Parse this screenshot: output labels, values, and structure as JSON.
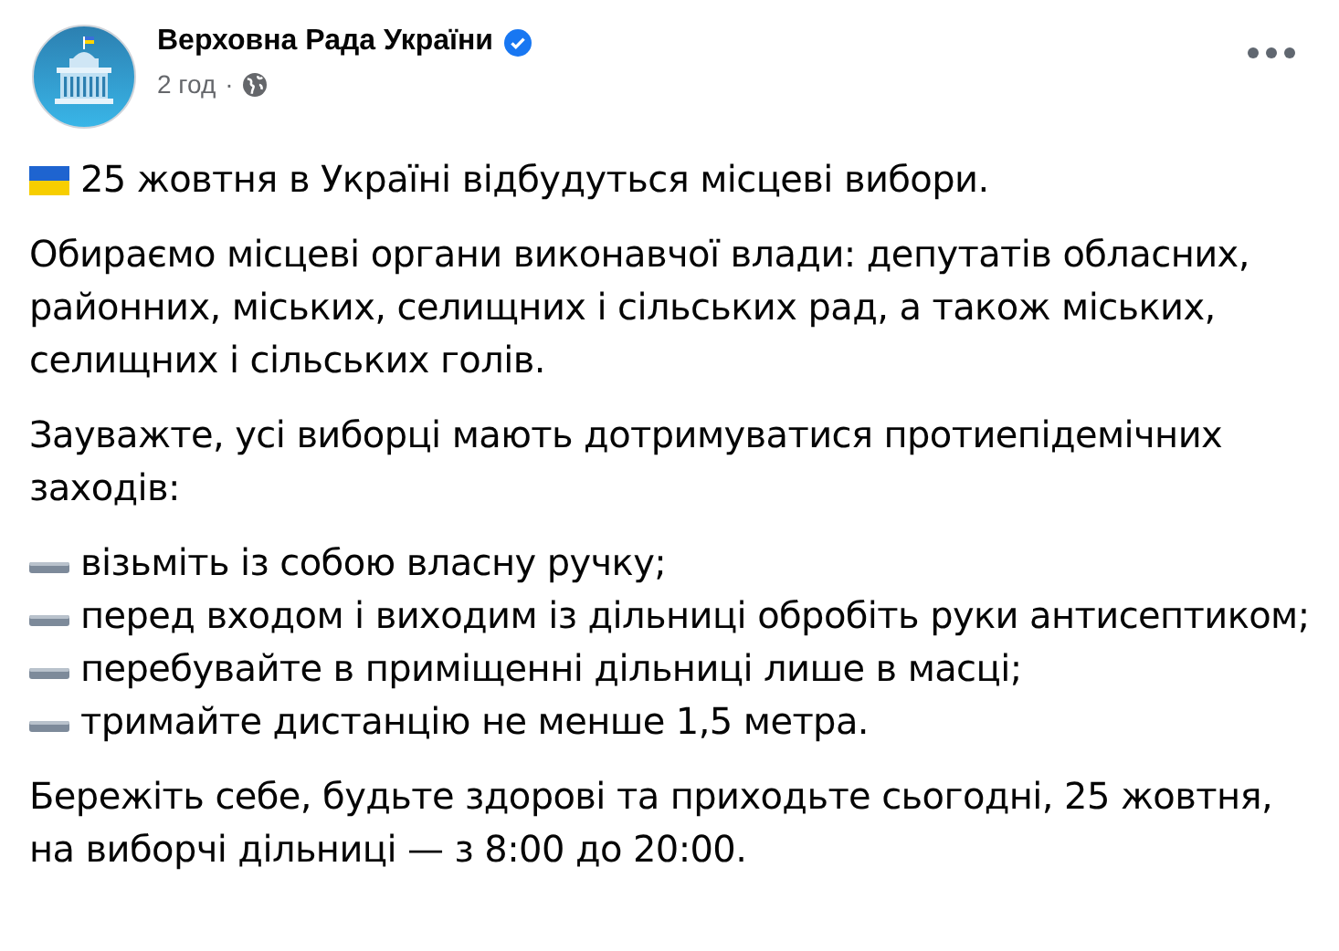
{
  "post": {
    "author": "Верховна Рада України",
    "verified": true,
    "time": "2 год",
    "separator": "·"
  },
  "paragraphs": [
    {
      "kind": "flag",
      "text": "25 жовтня в Україні відбудуться місцеві вибори."
    },
    {
      "kind": "plain",
      "text": "Обираємо місцеві органи виконавчої влади: депутатів обласних, районних, міських, селищних і сільських рад, а також міських, селищних і сільських голів."
    },
    {
      "kind": "plain",
      "text": "Зауважте, усі виборці мають дотримуватися протиепідемічних заходів:"
    },
    {
      "kind": "list",
      "items": [
        "візьміть із собою власну ручку;",
        "перед входом і виходим із дільниці обробіть руки антисептиком;",
        "перебувайте в приміщенні дільниці лише в масці;",
        "тримайте дистанцію не менше 1,5 метра."
      ]
    },
    {
      "kind": "plain",
      "text": "Бережіть себе, будьте здорові та приходьте сьогодні, 25 жовтня, на виборчі дільниці — з 8:00 до 20:00."
    }
  ]
}
